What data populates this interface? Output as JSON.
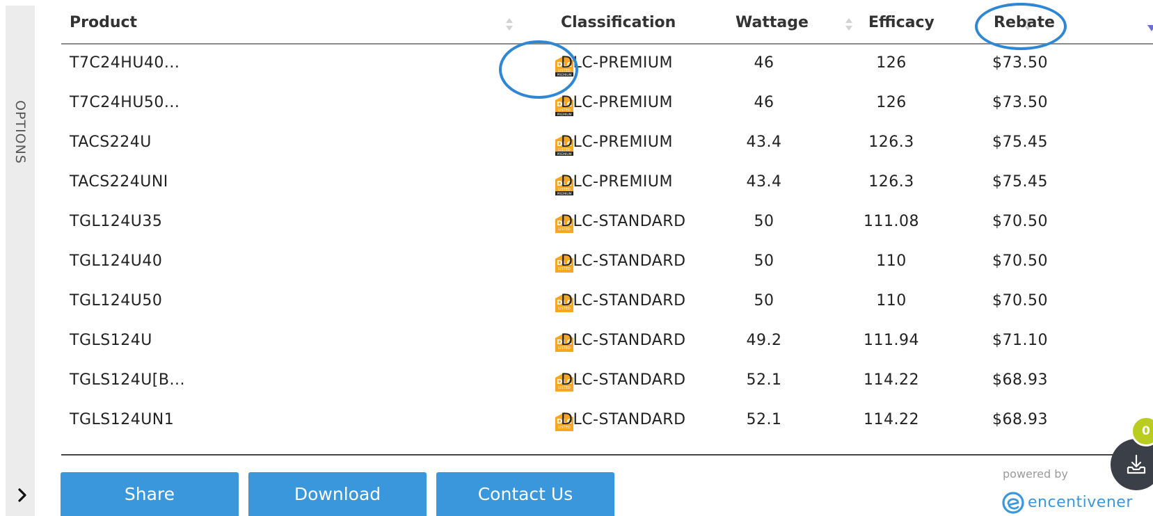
{
  "options_rail": {
    "label": "OPTIONS",
    "toggle_glyph": "›"
  },
  "table": {
    "columns": [
      {
        "key": "product",
        "label": "Product"
      },
      {
        "key": "classification",
        "label": "Classification"
      },
      {
        "key": "wattage",
        "label": "Wattage"
      },
      {
        "key": "efficacy",
        "label": "Efficacy"
      },
      {
        "key": "rebate",
        "label": "Rebate"
      }
    ],
    "rows": [
      {
        "product": "T7C24HU40...",
        "badge": "dlc-premium-icon",
        "classification": "DLC-PREMIUM",
        "wattage": "46",
        "efficacy": "126",
        "rebate": "$73.50"
      },
      {
        "product": "T7C24HU50...",
        "badge": "dlc-premium-icon",
        "classification": "DLC-PREMIUM",
        "wattage": "46",
        "efficacy": "126",
        "rebate": "$73.50"
      },
      {
        "product": "TACS224U",
        "badge": "dlc-premium-icon",
        "classification": "DLC-PREMIUM",
        "wattage": "43.4",
        "efficacy": "126.3",
        "rebate": "$75.45"
      },
      {
        "product": "TACS224UNI",
        "badge": "dlc-premium-icon",
        "classification": "DLC-PREMIUM",
        "wattage": "43.4",
        "efficacy": "126.3",
        "rebate": "$75.45"
      },
      {
        "product": "TGL124U35",
        "badge": "dlc-standard-icon",
        "classification": "DLC-STANDARD",
        "wattage": "50",
        "efficacy": "111.08",
        "rebate": "$70.50"
      },
      {
        "product": "TGL124U40",
        "badge": "dlc-standard-icon",
        "classification": "DLC-STANDARD",
        "wattage": "50",
        "efficacy": "110",
        "rebate": "$70.50"
      },
      {
        "product": "TGL124U50",
        "badge": "dlc-standard-icon",
        "classification": "DLC-STANDARD",
        "wattage": "50",
        "efficacy": "110",
        "rebate": "$70.50"
      },
      {
        "product": "TGLS124U",
        "badge": "dlc-standard-icon",
        "classification": "DLC-STANDARD",
        "wattage": "49.2",
        "efficacy": "111.94",
        "rebate": "$71.10"
      },
      {
        "product": "TGLS124U[B...",
        "badge": "dlc-standard-icon",
        "classification": "DLC-STANDARD",
        "wattage": "52.1",
        "efficacy": "114.22",
        "rebate": "$68.93"
      },
      {
        "product": "TGLS124UN1",
        "badge": "dlc-standard-icon",
        "classification": "DLC-STANDARD",
        "wattage": "52.1",
        "efficacy": "114.22",
        "rebate": "$68.93"
      }
    ]
  },
  "badge_text": {
    "top": "DLC",
    "middle": "LISTED",
    "premium": "PREMIUM"
  },
  "actions": {
    "share": "Share",
    "download": "Download",
    "contact": "Contact Us"
  },
  "branding": {
    "powered_by": "powered by",
    "name": "encentivener"
  },
  "download_queue": {
    "count": "0"
  },
  "colors": {
    "accent": "#3a97dc",
    "badge_orange": "#f5a623",
    "count_badge": "#b9cc1f",
    "annotation": "#2f86d3"
  }
}
